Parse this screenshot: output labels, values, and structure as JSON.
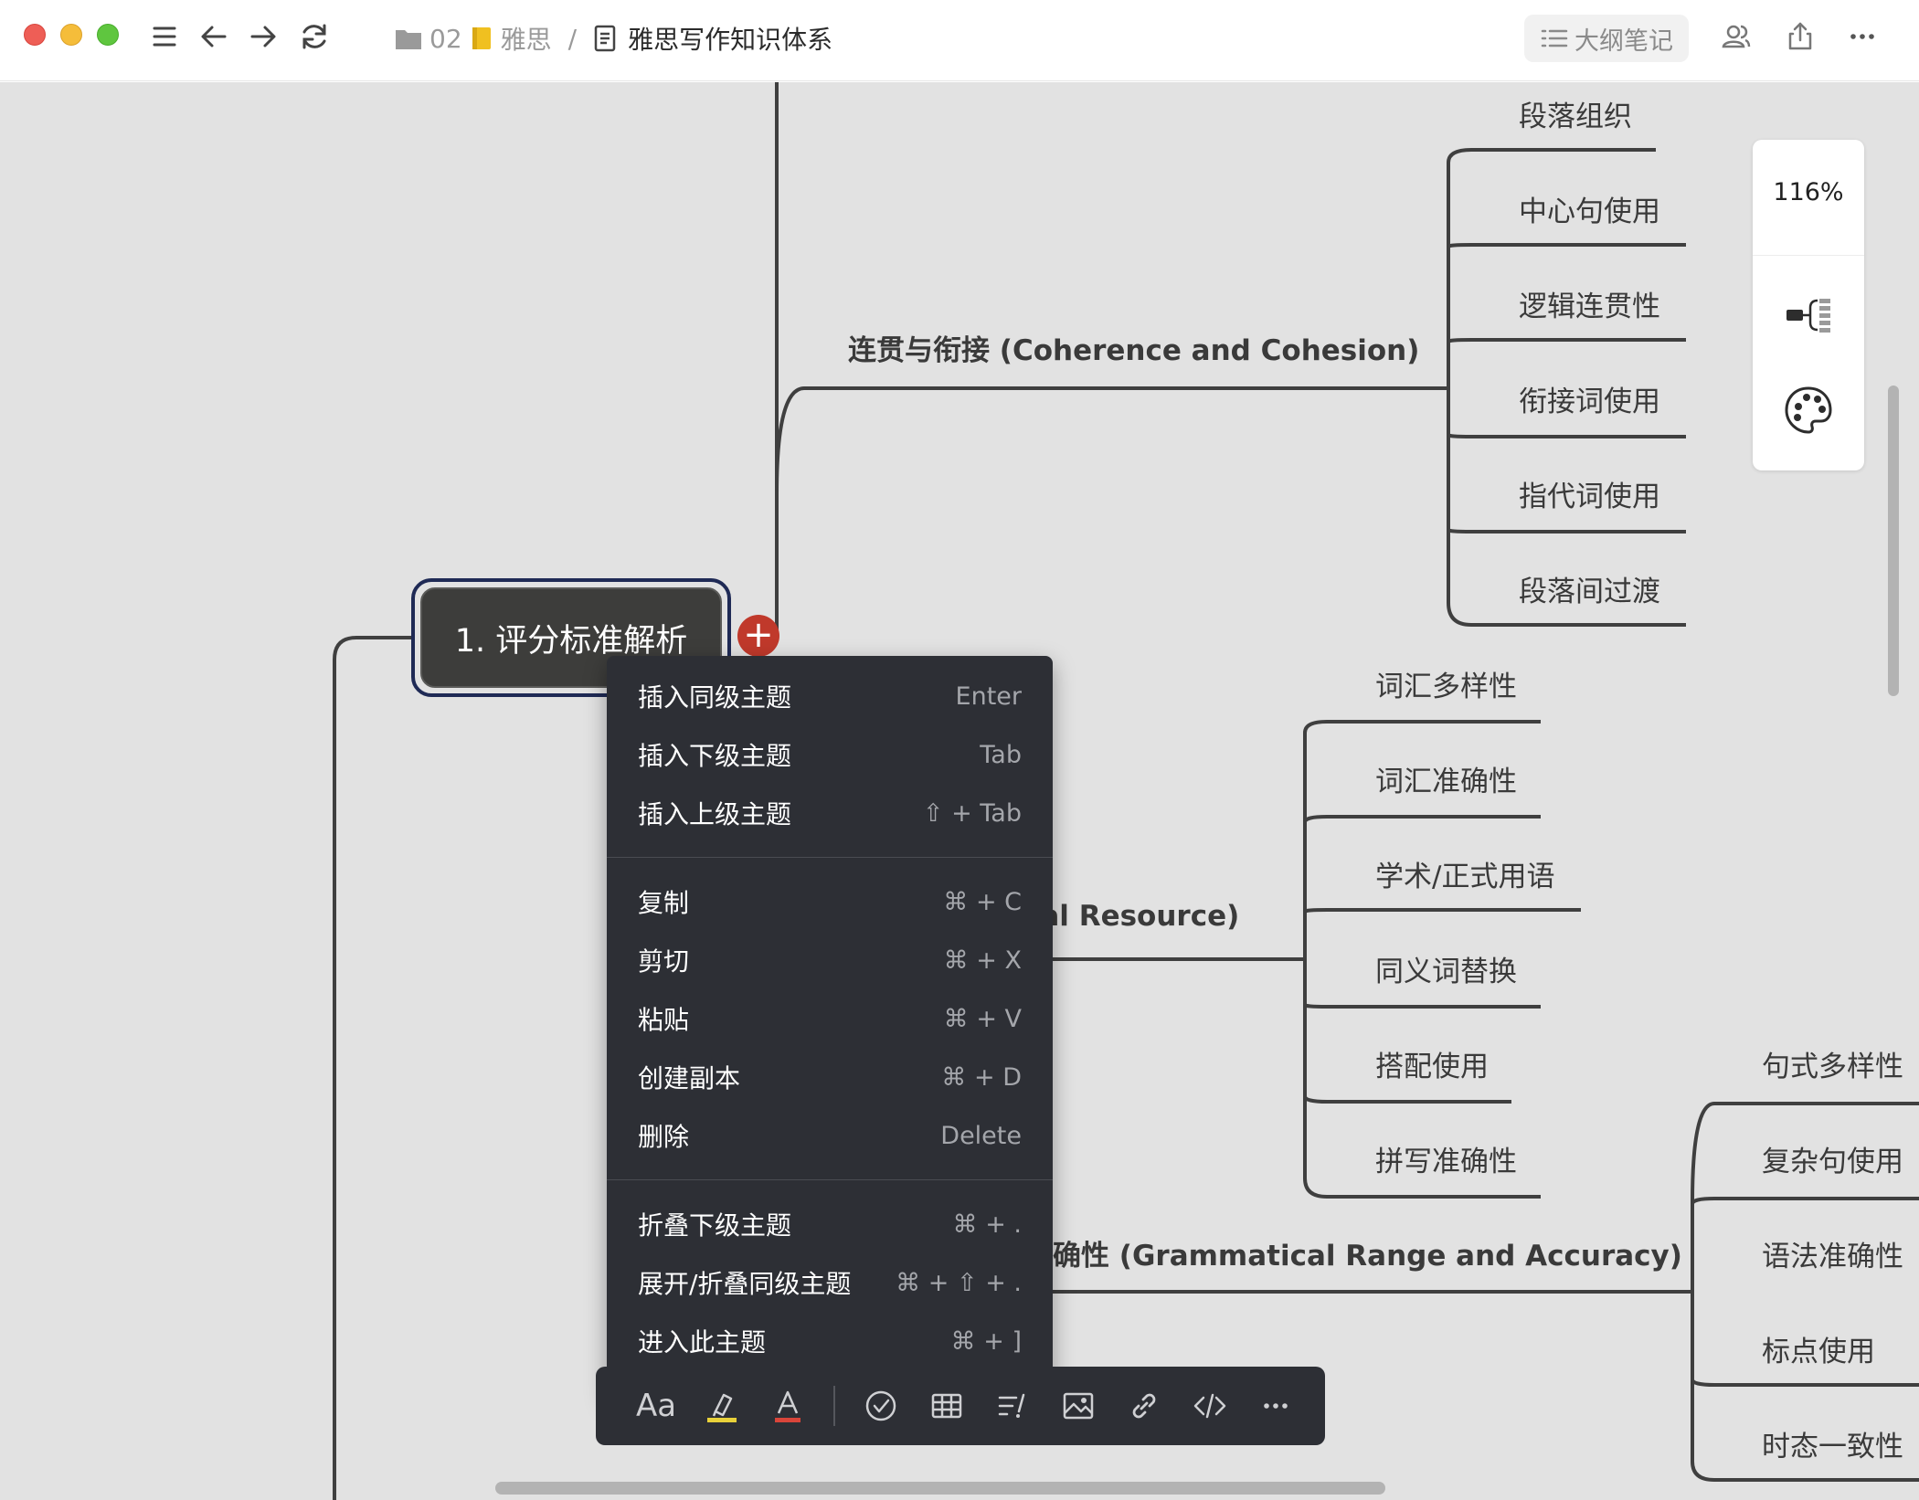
{
  "window": {
    "traffic_lights": [
      "close",
      "minimize",
      "zoom"
    ]
  },
  "toolbar": {
    "icons": [
      "menu-icon",
      "back-icon",
      "forward-icon",
      "refresh-icon"
    ],
    "breadcrumb": {
      "folder": "02",
      "notebook": "雅思",
      "separator": "/",
      "document": "雅思写作知识体系"
    },
    "outline_button": "大纲笔记",
    "right_icons": [
      "collaborators-icon",
      "share-icon",
      "more-icon"
    ]
  },
  "mindmap": {
    "root": "1. 评分标准解析",
    "branches": {
      "coherence": {
        "label": "连贯与衔接 (Coherence and Cohesion)",
        "children": [
          "段落组织",
          "中心句使用",
          "逻辑连贯性",
          "衔接词使用",
          "指代词使用",
          "段落间过渡"
        ]
      },
      "lexical": {
        "label": "cal Resource)",
        "children": [
          "词汇多样性",
          "词汇准确性",
          "学术/正式用语",
          "同义词替换",
          "搭配使用",
          "拼写准确性"
        ]
      },
      "grammar": {
        "label": "确性 (Grammatical Range and Accuracy)",
        "children": [
          "句式多样性",
          "复杂句使用",
          "语法准确性",
          "标点使用",
          "时态一致性"
        ]
      }
    }
  },
  "side_panel": {
    "zoom": "116%",
    "icons": [
      "layout-structure-icon",
      "palette-icon"
    ]
  },
  "context_menu": {
    "groups": [
      [
        {
          "label": "插入同级主题",
          "shortcut": "Enter"
        },
        {
          "label": "插入下级主题",
          "shortcut": "Tab"
        },
        {
          "label": "插入上级主题",
          "shortcut": "⇧ + Tab"
        }
      ],
      [
        {
          "label": "复制",
          "shortcut": "⌘ + C"
        },
        {
          "label": "剪切",
          "shortcut": "⌘ + X"
        },
        {
          "label": "粘贴",
          "shortcut": "⌘ + V"
        },
        {
          "label": "创建副本",
          "shortcut": "⌘ + D"
        },
        {
          "label": "删除",
          "shortcut": "Delete"
        }
      ],
      [
        {
          "label": "折叠下级主题",
          "shortcut": "⌘ + ."
        },
        {
          "label": "展开/折叠同级主题",
          "shortcut": "⌘ + ⇧ + ."
        },
        {
          "label": "进入此主题",
          "shortcut": "⌘ + ]"
        }
      ]
    ]
  },
  "format_toolbar": {
    "text_style": "Aa",
    "items": [
      "highlight-icon",
      "text-color-icon",
      "checkbox-icon",
      "table-icon",
      "list-icon",
      "image-icon",
      "link-icon",
      "code-icon",
      "more-icon"
    ]
  },
  "colors": {
    "canvas": "#e2e2e2",
    "root_node": "#3d3d3b",
    "root_border": "#1f2a55",
    "add_button": "#c0392b",
    "menu_bg": "#2d2f35",
    "highlight_yellow": "#e8d13a",
    "text_color_red": "#d9453a"
  }
}
